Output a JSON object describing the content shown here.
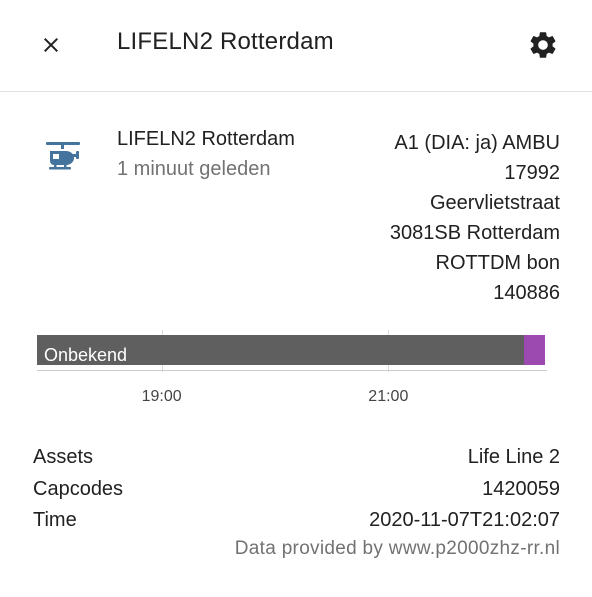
{
  "header": {
    "title": "LIFELN2 Rotterdam",
    "close_icon": "close-icon",
    "settings_icon": "gear-icon"
  },
  "entity": {
    "icon": "helicopter-icon",
    "icon_color": "#44739e",
    "name": "LIFELN2 Rotterdam",
    "last_changed": "1 minuut geleden",
    "state_lines": [
      "A1 (DIA: ja) AMBU",
      "17992",
      "Geervlietstraat",
      "3081SB Rotterdam",
      "ROTTDM bon",
      "140886"
    ]
  },
  "timeline": {
    "state_label": "Onbekend",
    "state_color": "#5f5f5f",
    "active_color": "#9c4ab0",
    "start_hour": 17.9,
    "end_hour": 22.4,
    "unknown_until_hour": 22.2,
    "ticks": [
      {
        "label": "19:00",
        "hour": 19
      },
      {
        "label": "21:00",
        "hour": 21
      }
    ]
  },
  "attributes": [
    {
      "key": "Assets",
      "value": "Life Line 2"
    },
    {
      "key": "Capcodes",
      "value": "1420059"
    },
    {
      "key": "Time",
      "value": "2020-11-07T21:02:07"
    }
  ],
  "attribution": "Data provided by www.p2000zhz-rr.nl"
}
